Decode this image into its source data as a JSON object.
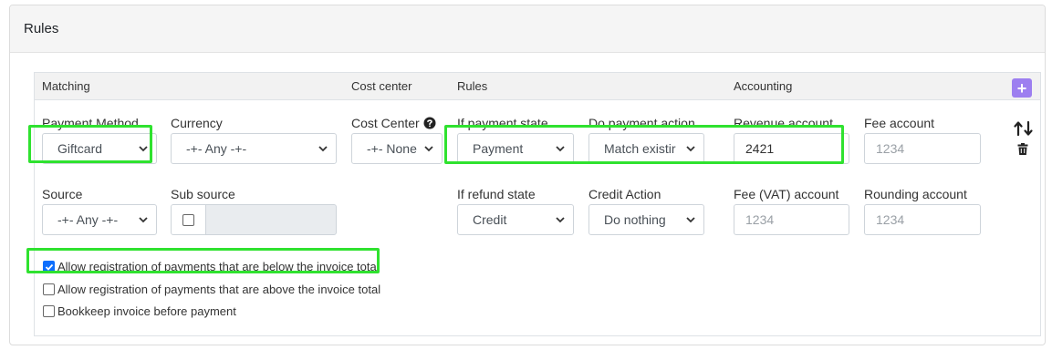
{
  "card": {
    "title": "Rules"
  },
  "table": {
    "headers": {
      "matching": "Matching",
      "cost_center": "Cost center",
      "rules": "Rules",
      "accounting": "Accounting"
    },
    "add_button_label": "+"
  },
  "fields": {
    "payment_method": {
      "label": "Payment Method",
      "value": "Giftcard"
    },
    "currency": {
      "label": "Currency",
      "value": "-+- Any -+-"
    },
    "cost_center": {
      "label": "Cost Center",
      "value": "-+- None"
    },
    "payment_state": {
      "label": "If payment state",
      "value": "Payment"
    },
    "payment_action": {
      "label": "Do payment action",
      "value": "Match existir"
    },
    "revenue_account": {
      "label": "Revenue account",
      "value": "2421"
    },
    "fee_account": {
      "label": "Fee account",
      "placeholder": "1234"
    },
    "source": {
      "label": "Source",
      "value": "-+- Any -+-"
    },
    "sub_source": {
      "label": "Sub source",
      "checked": false
    },
    "refund_state": {
      "label": "If refund state",
      "value": "Credit"
    },
    "credit_action": {
      "label": "Credit Action",
      "value": "Do nothing"
    },
    "fee_vat_account": {
      "label": "Fee (VAT) account",
      "placeholder": "1234"
    },
    "rounding_account": {
      "label": "Rounding account",
      "placeholder": "1234"
    }
  },
  "options": [
    {
      "label": "Allow registration of payments that are below the invoice total",
      "checked": true
    },
    {
      "label": "Allow registration of payments that are above the invoice total",
      "checked": false
    },
    {
      "label": "Bookkeep invoice before payment",
      "checked": false
    }
  ],
  "icons": {
    "help": "question-circle-icon",
    "sort": "sort-arrows-icon",
    "delete": "trash-icon",
    "dropdown": "chevron-down-icon",
    "add": "plus-icon"
  },
  "colors": {
    "accent_purple": "#9d7ff0",
    "highlight_green": "#2fe22f",
    "checkbox_blue": "#0d6efd"
  }
}
